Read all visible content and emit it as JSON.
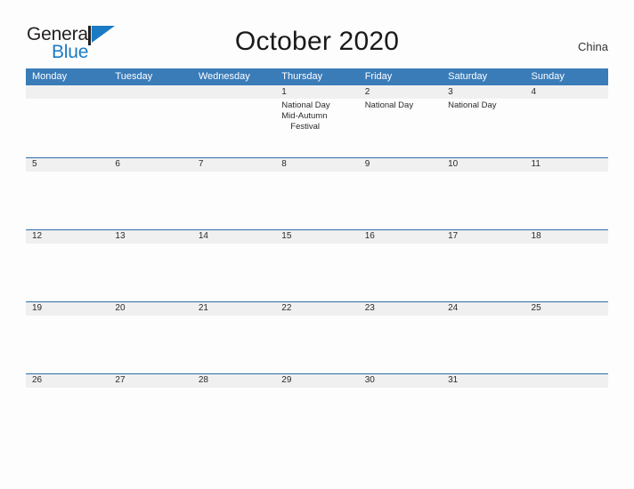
{
  "brand": {
    "name_part1": "General",
    "name_part2": "Blue",
    "flag_icon": "flag-triangle-icon",
    "accent_color": "#1b7ac4"
  },
  "header": {
    "title": "October 2020",
    "country": "China"
  },
  "theme": {
    "header_blue": "#3a7cb8",
    "rule_blue": "#2e6ea8",
    "band_gray": "#f0f0f0",
    "text_dark": "#2a2a2a"
  },
  "calendar": {
    "weekdays": [
      "Monday",
      "Tuesday",
      "Wednesday",
      "Thursday",
      "Friday",
      "Saturday",
      "Sunday"
    ],
    "weeks": [
      {
        "days": [
          {
            "number": "",
            "events": []
          },
          {
            "number": "",
            "events": []
          },
          {
            "number": "",
            "events": []
          },
          {
            "number": "1",
            "events": [
              "National Day",
              "Mid-Autumn Festival"
            ]
          },
          {
            "number": "2",
            "events": [
              "National Day"
            ]
          },
          {
            "number": "3",
            "events": [
              "National Day"
            ]
          },
          {
            "number": "4",
            "events": []
          }
        ]
      },
      {
        "days": [
          {
            "number": "5",
            "events": []
          },
          {
            "number": "6",
            "events": []
          },
          {
            "number": "7",
            "events": []
          },
          {
            "number": "8",
            "events": []
          },
          {
            "number": "9",
            "events": []
          },
          {
            "number": "10",
            "events": []
          },
          {
            "number": "11",
            "events": []
          }
        ]
      },
      {
        "days": [
          {
            "number": "12",
            "events": []
          },
          {
            "number": "13",
            "events": []
          },
          {
            "number": "14",
            "events": []
          },
          {
            "number": "15",
            "events": []
          },
          {
            "number": "16",
            "events": []
          },
          {
            "number": "17",
            "events": []
          },
          {
            "number": "18",
            "events": []
          }
        ]
      },
      {
        "days": [
          {
            "number": "19",
            "events": []
          },
          {
            "number": "20",
            "events": []
          },
          {
            "number": "21",
            "events": []
          },
          {
            "number": "22",
            "events": []
          },
          {
            "number": "23",
            "events": []
          },
          {
            "number": "24",
            "events": []
          },
          {
            "number": "25",
            "events": []
          }
        ]
      },
      {
        "days": [
          {
            "number": "26",
            "events": []
          },
          {
            "number": "27",
            "events": []
          },
          {
            "number": "28",
            "events": []
          },
          {
            "number": "29",
            "events": []
          },
          {
            "number": "30",
            "events": []
          },
          {
            "number": "31",
            "events": []
          },
          {
            "number": "",
            "events": []
          }
        ]
      }
    ]
  }
}
